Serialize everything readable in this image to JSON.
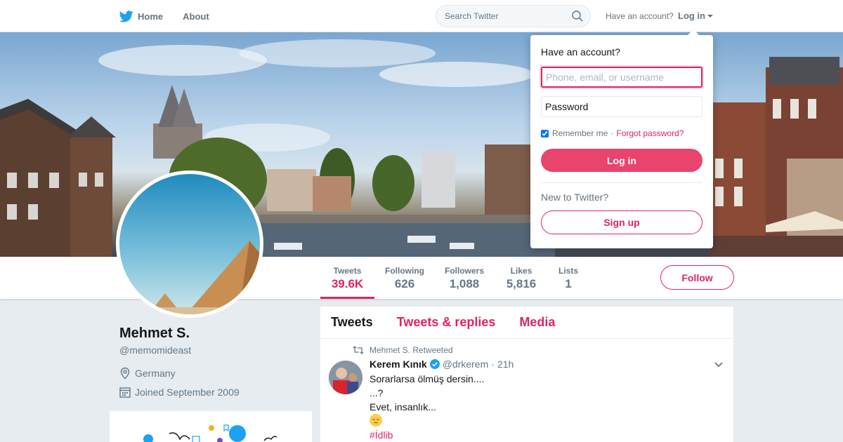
{
  "nav": {
    "home_label": "Home",
    "about_label": "About",
    "search_placeholder": "Search Twitter",
    "have_account_label": "Have an account?",
    "login_label": "Log in"
  },
  "profile": {
    "name": "Mehmet S.",
    "handle": "@memomideast",
    "location": "Germany",
    "joined": "Joined September 2009"
  },
  "stats": [
    {
      "label": "Tweets",
      "value": "39.6K"
    },
    {
      "label": "Following",
      "value": "626"
    },
    {
      "label": "Followers",
      "value": "1,088"
    },
    {
      "label": "Likes",
      "value": "5,816"
    },
    {
      "label": "Lists",
      "value": "1"
    }
  ],
  "follow_label": "Follow",
  "timeline": {
    "tabs": [
      "Tweets",
      "Tweets & replies",
      "Media"
    ],
    "tweet": {
      "retweet_context": "Mehmet S. Retweeted",
      "author_name": "Kerem Kınık",
      "author_handle": "@drkerem",
      "dot": "·",
      "time": "21h",
      "lines": [
        "Sorarlarsa ölmüş dersin....",
        "...?",
        "Evet, insanlık..."
      ],
      "hashtag": "#İdlib"
    }
  },
  "login_dropdown": {
    "title": "Have an account?",
    "username_placeholder": "Phone, email, or username",
    "password_placeholder": "Password",
    "remember_label": "Remember me",
    "separator": "·",
    "forgot_label": "Forgot password?",
    "login_button": "Log in",
    "new_to_label": "New to Twitter?",
    "signup_button": "Sign up"
  },
  "colors": {
    "accent": "#e0245e",
    "twitter_blue": "#1da1f2",
    "background": "#e6ecf0"
  },
  "icons": [
    "twitter-bird-icon",
    "search-icon",
    "location-icon",
    "calendar-icon",
    "retweet-icon",
    "verified-icon",
    "chevron-down-icon"
  ]
}
